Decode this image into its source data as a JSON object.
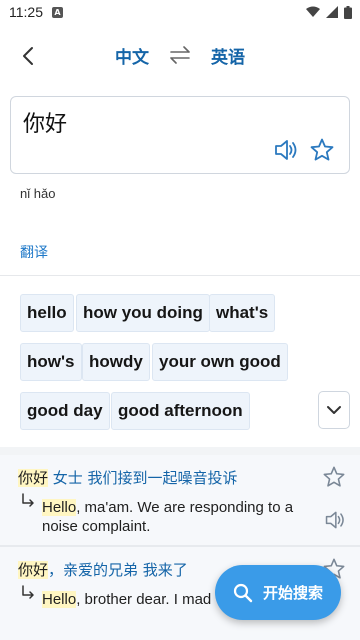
{
  "status_bar": {
    "time": "11:25",
    "badge": "A"
  },
  "header": {
    "source_lang": "中文",
    "target_lang": "英语"
  },
  "input": {
    "text": "你好"
  },
  "pinyin": "nǐ hǎo",
  "tabs": [
    {
      "label": "翻译",
      "active": true
    }
  ],
  "translations": [
    "hello",
    "how you doing",
    "what's",
    "how's",
    "howdy",
    "your own good",
    "good day",
    "good afternoon"
  ],
  "examples": [
    {
      "zh_highlight": "你好",
      "zh_rest": " 女士 我们接到一起噪音投诉",
      "en_highlight": "Hello",
      "en_rest": ", ma'am. We are responding to a noise complaint."
    },
    {
      "zh_highlight": "你好",
      "zh_rest": "，亲爱的兄弟 我来了",
      "en_highlight": "Hello",
      "en_rest": ", brother dear. I mad"
    }
  ],
  "fab": {
    "label": "开始搜索"
  },
  "colors": {
    "accent": "#1565a8",
    "chip_bg": "#eef4fb",
    "fab_bg": "#3a9be8",
    "highlight": "#fff6c2"
  },
  "icons": [
    "back-arrow-icon",
    "swap-icon",
    "speaker-icon",
    "star-icon",
    "chevron-down-icon",
    "reply-arrow-icon",
    "search-icon"
  ]
}
